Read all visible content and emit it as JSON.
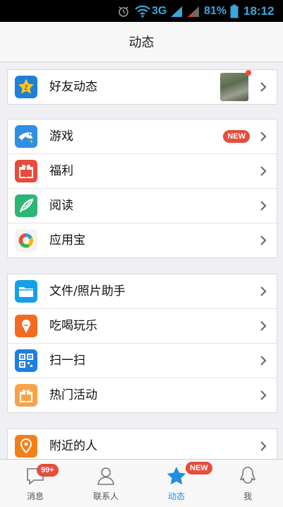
{
  "status_bar": {
    "network": "3G",
    "battery": "81%",
    "time": "18:12"
  },
  "header": {
    "title": "动态"
  },
  "groups": [
    {
      "items": [
        {
          "label": "好友动态",
          "icon": "star-icon"
        }
      ]
    },
    {
      "items": [
        {
          "label": "游戏",
          "icon": "game-shark-icon",
          "badge": "NEW"
        },
        {
          "label": "福利",
          "icon": "gift-icon"
        },
        {
          "label": "阅读",
          "icon": "feather-icon"
        },
        {
          "label": "应用宝",
          "icon": "appstore-icon"
        }
      ]
    },
    {
      "items": [
        {
          "label": "文件/照片助手",
          "icon": "folder-icon"
        },
        {
          "label": "吃喝玩乐",
          "icon": "icecream-icon"
        },
        {
          "label": "扫一扫",
          "icon": "qrcode-icon"
        },
        {
          "label": "热门活动",
          "icon": "present-icon"
        }
      ]
    },
    {
      "items": [
        {
          "label": "附近的人",
          "icon": "location-icon"
        }
      ]
    }
  ],
  "tabbar": {
    "tabs": [
      {
        "label": "消息",
        "icon": "message-icon",
        "badge": "99+"
      },
      {
        "label": "联系人",
        "icon": "contacts-icon"
      },
      {
        "label": "动态",
        "icon": "star-icon",
        "badge": "NEW",
        "active": true
      },
      {
        "label": "我",
        "icon": "penguin-icon"
      }
    ]
  },
  "colors": {
    "accent": "#1e8fe1",
    "badge": "#e74c3c",
    "background": "#efeff4"
  }
}
